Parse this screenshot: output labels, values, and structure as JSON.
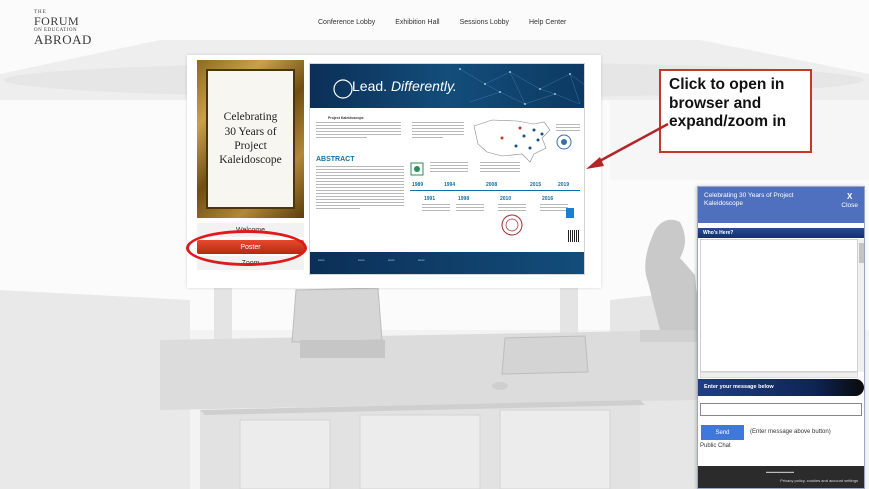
{
  "header": {
    "logo": {
      "the": "THE",
      "forum": "FORUM",
      "on": "ON EDUCATION",
      "abroad": "ABROAD"
    },
    "nav": [
      "Conference Lobby",
      "Exhibition Hall",
      "Sessions Lobby",
      "Help Center"
    ]
  },
  "booth": {
    "frame_text": "Celebrating\n30 Years of\nProject\nKaleidoscope",
    "buttons": {
      "welcome": "Welcome",
      "poster": "Poster",
      "zoom": "Zoom"
    }
  },
  "poster": {
    "lead": "Lead.",
    "differently": "Differently.",
    "subhead": "Project Kaleidoscope",
    "abstract_heading": "ABSTRACT",
    "timeline_top": [
      "1989",
      "1994",
      "2008",
      "2015",
      "2019"
    ],
    "timeline_bottom": [
      "1991",
      "1998",
      "2010",
      "2016"
    ]
  },
  "callout": {
    "text": "Click to open in\nbrowser and\nexpand/zoom in"
  },
  "chat": {
    "title": "Celebrating 30 Years of Project Kaleidoscope",
    "close_x": "X",
    "close_label": "Close",
    "whos_here": "Who's Here?",
    "enter_message": "Enter your message below",
    "input_value": "",
    "send_label": "Send",
    "send_hint": "(Enter message above button)",
    "public_chat": "Public Chat",
    "privacy": "Privacy policy, cookies and account settings"
  },
  "colors": {
    "accent_red": "#e01a1a",
    "chat_header": "#4f6fbf",
    "poster_navy": "#0b2f57"
  }
}
